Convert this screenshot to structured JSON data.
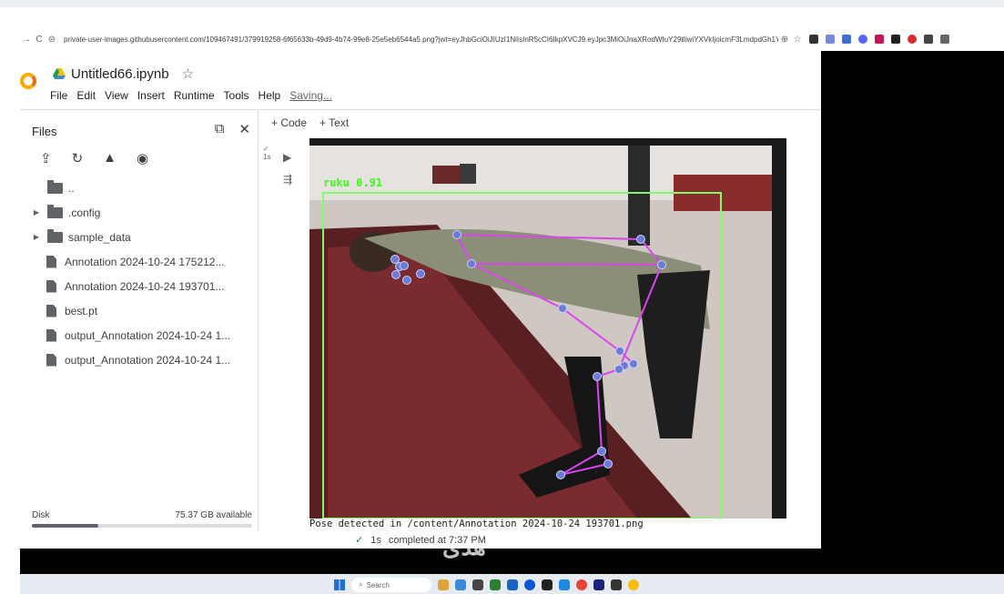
{
  "browser": {
    "url": "private-user-images.githubusercontent.com/109467491/379919258-6f65633b-49d9-4b74-99e8-25e5eb6544a5.png?jwt=eyJhbGciOiJIUzI1NiIsInR5cCI6IkpXVCJ9.eyJpc3MiOiJnaXRodWIuY29tIiwiYXVkIjoicmF3LmdpdGh1YnVzZ..."
  },
  "notebook": {
    "title": "Untitled66.ipynb",
    "menu": [
      "File",
      "Edit",
      "View",
      "Insert",
      "Runtime",
      "Tools",
      "Help"
    ],
    "saving": "Saving..."
  },
  "sidebar": {
    "title": "Files",
    "items": [
      {
        "name": "..",
        "type": "parent"
      },
      {
        "name": ".config",
        "type": "folder"
      },
      {
        "name": "sample_data",
        "type": "folder"
      },
      {
        "name": "Annotation 2024-10-24 175212...",
        "type": "file"
      },
      {
        "name": "Annotation 2024-10-24 193701...",
        "type": "file"
      },
      {
        "name": "best.pt",
        "type": "file"
      },
      {
        "name": "output_Annotation 2024-10-24 1...",
        "type": "file"
      },
      {
        "name": "output_Annotation 2024-10-24 1...",
        "type": "file"
      }
    ],
    "disk_label": "Disk",
    "disk_available": "75.37 GB available",
    "disk_used_fraction": 0.3
  },
  "toolbar": {
    "code": "+ Code",
    "text": "+ Text"
  },
  "cell": {
    "exec_time": "1s"
  },
  "output": {
    "detection_label": "ruku 0.91",
    "text": "Pose detected in /content/Annotation 2024-10-24 193701.png"
  },
  "status": {
    "check": "✓",
    "time": "1s",
    "message": "completed at 7:37 PM"
  },
  "taskbar": {
    "search_placeholder": "Search"
  },
  "watermark": "هدى",
  "colors": {
    "skeleton": "#d946ef",
    "keypoint": "#6b7bd6",
    "bbox": "#7dff6a",
    "label": "#39ff14"
  }
}
